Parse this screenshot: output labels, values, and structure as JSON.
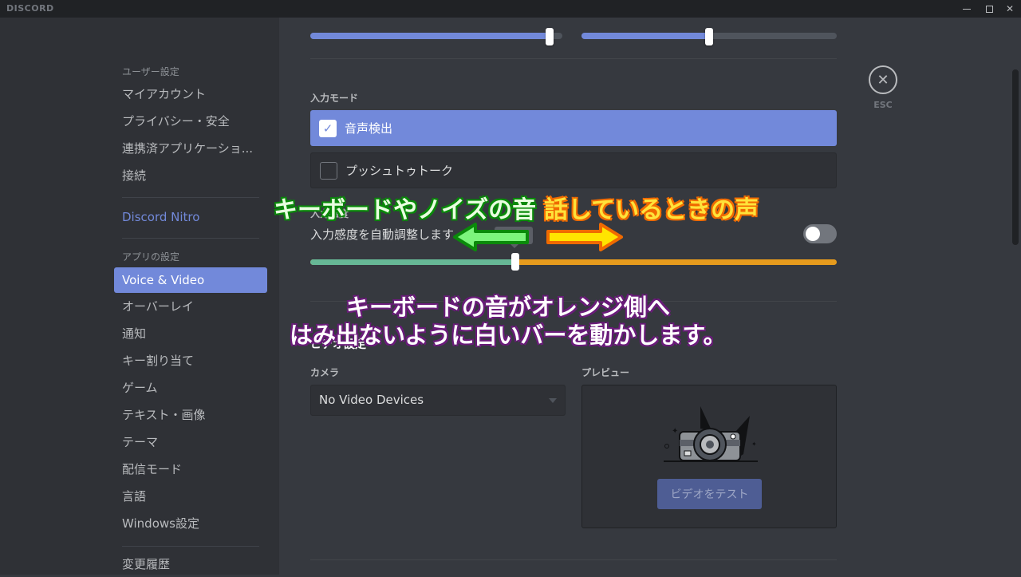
{
  "window": {
    "brand": "DISCORD",
    "controls": [
      "minimize",
      "maximize",
      "close"
    ]
  },
  "sidebar": {
    "user_settings_header": "ユーザー設定",
    "user_items": [
      {
        "label": "マイアカウント"
      },
      {
        "label": "プライバシー・安全"
      },
      {
        "label": "連携済アプリケーショ..."
      },
      {
        "label": "接続"
      }
    ],
    "nitro_label": "Discord Nitro",
    "app_settings_header": "アプリの設定",
    "app_items": [
      {
        "label": "Voice & Video",
        "active": true
      },
      {
        "label": "オーバーレイ"
      },
      {
        "label": "通知"
      },
      {
        "label": "キー割り当て"
      },
      {
        "label": "ゲーム"
      },
      {
        "label": "テキスト・画像"
      },
      {
        "label": "テーマ"
      },
      {
        "label": "配信モード"
      },
      {
        "label": "言語"
      },
      {
        "label": "Windows設定"
      }
    ],
    "changelog_label": "変更履歴"
  },
  "main": {
    "volume_sliders": {
      "input_volume_fraction": 0.95,
      "output_volume_fraction": 0.5
    },
    "input_mode": {
      "label": "入力モード",
      "options": [
        {
          "label": "音声検出",
          "selected": true
        },
        {
          "label": "プッシュトゥトーク",
          "selected": false
        }
      ]
    },
    "sensitivity": {
      "label": "入力感度",
      "auto_label": "入力感度を自動調整します",
      "auto_enabled": false,
      "threshold_fraction": 0.39
    },
    "video": {
      "section_label": "ビデオ設定",
      "camera_label": "カメラ",
      "camera_value": "No Video Devices",
      "preview_label": "プレビュー",
      "test_button": "ビデオをテスト"
    },
    "esc_label": "ESC"
  },
  "captions": {
    "green": "キーボードやノイズの音",
    "orange": "話しているときの声",
    "purple_line1": "キーボードの音がオレンジ側へ",
    "purple_line2": "はみ出ないように白いバーを動かします。"
  }
}
